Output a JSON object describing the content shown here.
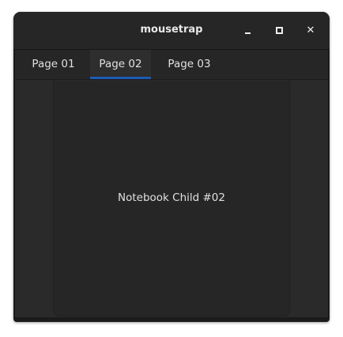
{
  "window": {
    "title": "mousetrap",
    "minimize_icon": "minimize-icon",
    "maximize_icon": "maximize-icon",
    "close_icon": "close-icon"
  },
  "notebook": {
    "tabs": [
      {
        "label": "Page 01"
      },
      {
        "label": "Page 02",
        "active": true
      },
      {
        "label": "Page 03"
      }
    ],
    "accent": "#1c5bb5"
  },
  "content": {
    "label": "Notebook Child #02"
  }
}
